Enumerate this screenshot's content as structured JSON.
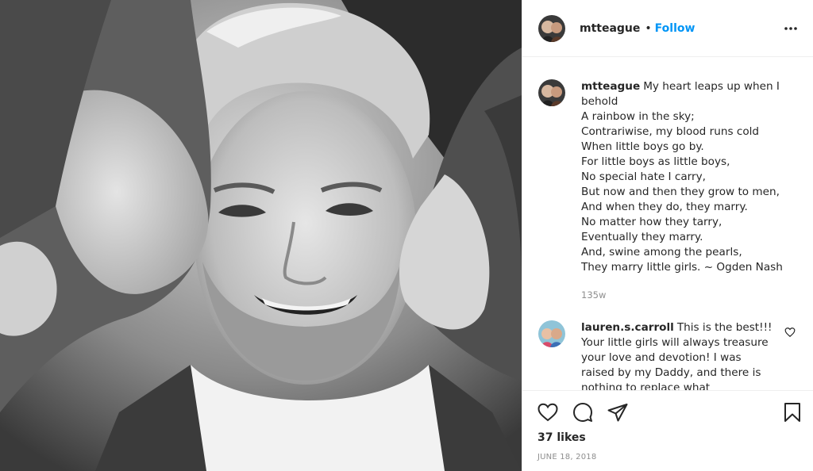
{
  "post": {
    "image_alt": "Black and white photo of a smiling man with two girls kissing his cheeks"
  },
  "header": {
    "username": "mtteague",
    "separator": "•",
    "follow_label": "Follow",
    "more_icon": "more-horizontal-icon"
  },
  "caption": {
    "username": "mtteague",
    "lines": [
      "My heart leaps up when I",
      "behold",
      "A rainbow in the sky;",
      "Contrariwise, my blood runs cold",
      "When little boys go by.",
      "For little boys as little boys,",
      "No special hate I carry,",
      "But now and then they grow to men,",
      "And when they do, they marry.",
      "No matter how they tarry,",
      "Eventually they marry.",
      "And, swine among the pearls,",
      "They marry little girls. ~ Ogden Nash"
    ],
    "time_ago": "135w"
  },
  "comment": {
    "username": "lauren.s.carroll",
    "text_first": "This is the best!!!",
    "lines": [
      "Your little girls will always treasure",
      "your love and devotion! I was",
      "raised by my Daddy, and there is",
      "nothing to replace what"
    ]
  },
  "actions": {
    "like_icon": "heart-icon",
    "comment_icon": "comment-icon",
    "share_icon": "share-icon",
    "save_icon": "bookmark-icon",
    "likes": "37 likes",
    "date": "JUNE 18, 2018"
  },
  "colors": {
    "link": "#0095f6",
    "text": "#262626",
    "muted": "#8e8e8e",
    "border": "#efefef"
  }
}
